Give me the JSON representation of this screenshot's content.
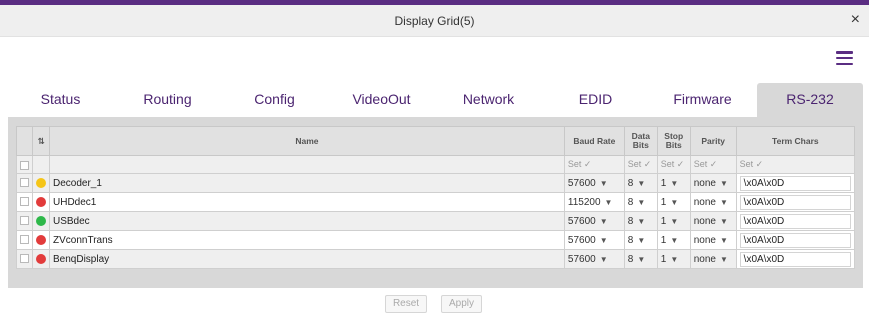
{
  "window": {
    "title": "Display Grid(5)",
    "close_glyph": "×"
  },
  "menu": {
    "icon": "hamburger-menu-icon"
  },
  "tabs": [
    {
      "label": "Status"
    },
    {
      "label": "Routing"
    },
    {
      "label": "Config"
    },
    {
      "label": "VideoOut"
    },
    {
      "label": "Network"
    },
    {
      "label": "EDID"
    },
    {
      "label": "Firmware"
    },
    {
      "label": "RS-232",
      "active": true
    }
  ],
  "table": {
    "headers": {
      "name": "Name",
      "baud": "Baud Rate",
      "data_bits": "Data Bits",
      "stop_bits": "Stop Bits",
      "parity": "Parity",
      "term": "Term Chars"
    },
    "set_label": "Set ✓",
    "rows": [
      {
        "status": "yellow",
        "name": "Decoder_1",
        "baud": "57600",
        "data_bits": "8",
        "stop_bits": "1",
        "parity": "none",
        "term": "\\x0A\\x0D"
      },
      {
        "status": "red",
        "name": "UHDdec1",
        "baud": "115200",
        "data_bits": "8",
        "stop_bits": "1",
        "parity": "none",
        "term": "\\x0A\\x0D"
      },
      {
        "status": "green",
        "name": "USBdec",
        "baud": "57600",
        "data_bits": "8",
        "stop_bits": "1",
        "parity": "none",
        "term": "\\x0A\\x0D"
      },
      {
        "status": "red",
        "name": "ZVconnTrans",
        "baud": "57600",
        "data_bits": "8",
        "stop_bits": "1",
        "parity": "none",
        "term": "\\x0A\\x0D"
      },
      {
        "status": "red",
        "name": "BenqDisplay",
        "baud": "57600",
        "data_bits": "8",
        "stop_bits": "1",
        "parity": "none",
        "term": "\\x0A\\x0D"
      }
    ]
  },
  "buttons": {
    "reset": "Reset",
    "apply": "Apply"
  },
  "colors": {
    "accent": "#5a2d82",
    "green": "#2eb84a",
    "red": "#e23b3b",
    "yellow": "#f5c518"
  }
}
